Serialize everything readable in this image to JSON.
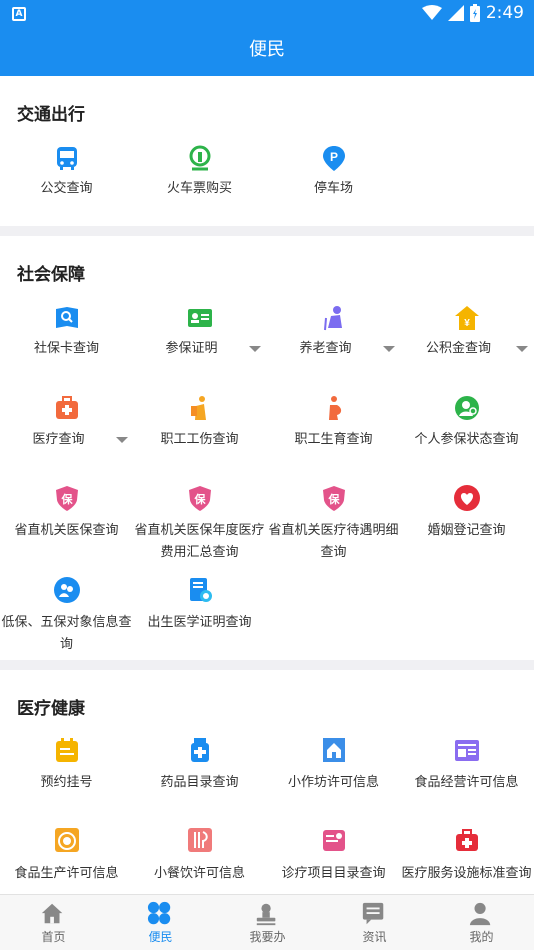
{
  "status_bar": {
    "time": "2:49",
    "left_badge": "A"
  },
  "title": "便民",
  "sections": [
    {
      "title": "交通出行",
      "items": [
        {
          "label": "公交查询",
          "icon": "bus-icon"
        },
        {
          "label": "火车票购买",
          "icon": "train-icon"
        },
        {
          "label": "停车场",
          "icon": "parking-icon"
        }
      ]
    },
    {
      "title": "社会保障",
      "items": [
        {
          "label": "社保卡查询",
          "icon": "social-card-icon"
        },
        {
          "label": "参保证明",
          "icon": "id-card-icon",
          "dropdown": true
        },
        {
          "label": "养老查询",
          "icon": "elderly-icon",
          "dropdown": true
        },
        {
          "label": "公积金查询",
          "icon": "fund-icon",
          "dropdown": true
        },
        {
          "label": "医疗查询",
          "icon": "medical-kit-icon",
          "dropdown": true
        },
        {
          "label": "职工工伤查询",
          "icon": "injury-icon"
        },
        {
          "label": "职工生育查询",
          "icon": "maternity-icon"
        },
        {
          "label": "个人参保状态查询",
          "icon": "person-status-icon"
        },
        {
          "label": "省直机关医保查询",
          "icon": "shield-insurance-icon"
        },
        {
          "label": "省直机关医保年度医疗费用汇总查询",
          "icon": "shield-insurance-icon"
        },
        {
          "label": "省直机关医疗待遇明细查询",
          "icon": "shield-insurance-icon"
        },
        {
          "label": "婚姻登记查询",
          "icon": "marriage-icon"
        },
        {
          "label": "低保、五保对象信息查询",
          "icon": "welfare-icon"
        },
        {
          "label": "出生医学证明查询",
          "icon": "birth-certificate-icon"
        }
      ]
    },
    {
      "title": "医疗健康",
      "items": [
        {
          "label": "预约挂号",
          "icon": "appointment-icon"
        },
        {
          "label": "药品目录查询",
          "icon": "medicine-icon"
        },
        {
          "label": "小作坊许可信息",
          "icon": "workshop-icon"
        },
        {
          "label": "食品经营许可信息",
          "icon": "food-business-icon"
        },
        {
          "label": "食品生产许可信息",
          "icon": "food-production-icon"
        },
        {
          "label": "小餐饮许可信息",
          "icon": "catering-icon"
        },
        {
          "label": "诊疗项目目录查询",
          "icon": "diagnosis-icon"
        },
        {
          "label": "医疗服务设施标准查询",
          "icon": "medical-facility-icon"
        }
      ]
    }
  ],
  "tabs": [
    {
      "label": "首页",
      "icon": "home-icon",
      "active": false
    },
    {
      "label": "便民",
      "icon": "grid-icon",
      "active": true
    },
    {
      "label": "我要办",
      "icon": "stamp-icon",
      "active": false
    },
    {
      "label": "资讯",
      "icon": "message-icon",
      "active": false
    },
    {
      "label": "我的",
      "icon": "profile-icon",
      "active": false
    }
  ],
  "colors": {
    "primary": "#1a8df0",
    "background": "#f0f0f3"
  }
}
